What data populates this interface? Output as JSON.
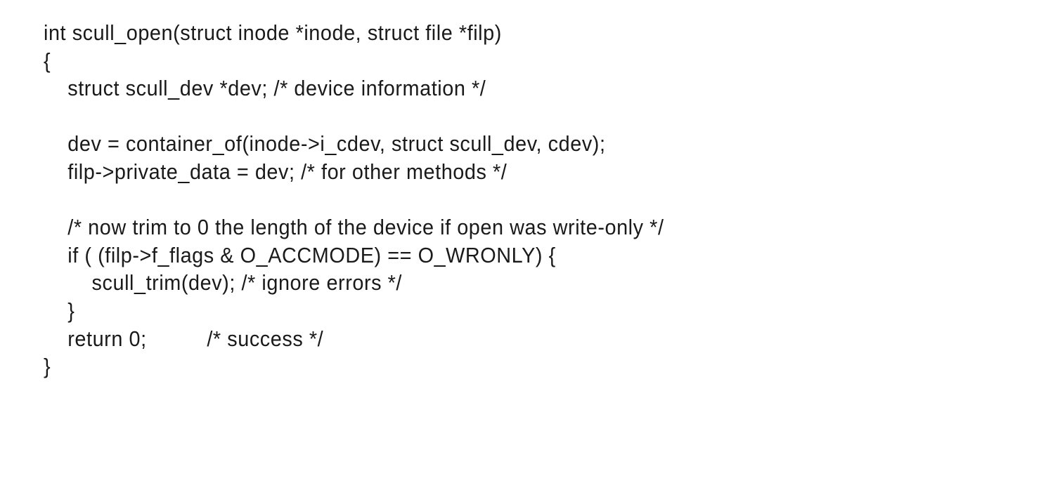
{
  "code": {
    "lines": [
      "int scull_open(struct inode *inode, struct file *filp)",
      "{",
      "    struct scull_dev *dev; /* device information */",
      "",
      "    dev = container_of(inode->i_cdev, struct scull_dev, cdev);",
      "    filp->private_data = dev; /* for other methods */",
      "",
      "    /* now trim to 0 the length of the device if open was write-only */",
      "    if ( (filp->f_flags & O_ACCMODE) == O_WRONLY) {",
      "        scull_trim(dev); /* ignore errors */",
      "    }",
      "    return 0;          /* success */",
      "}"
    ]
  }
}
